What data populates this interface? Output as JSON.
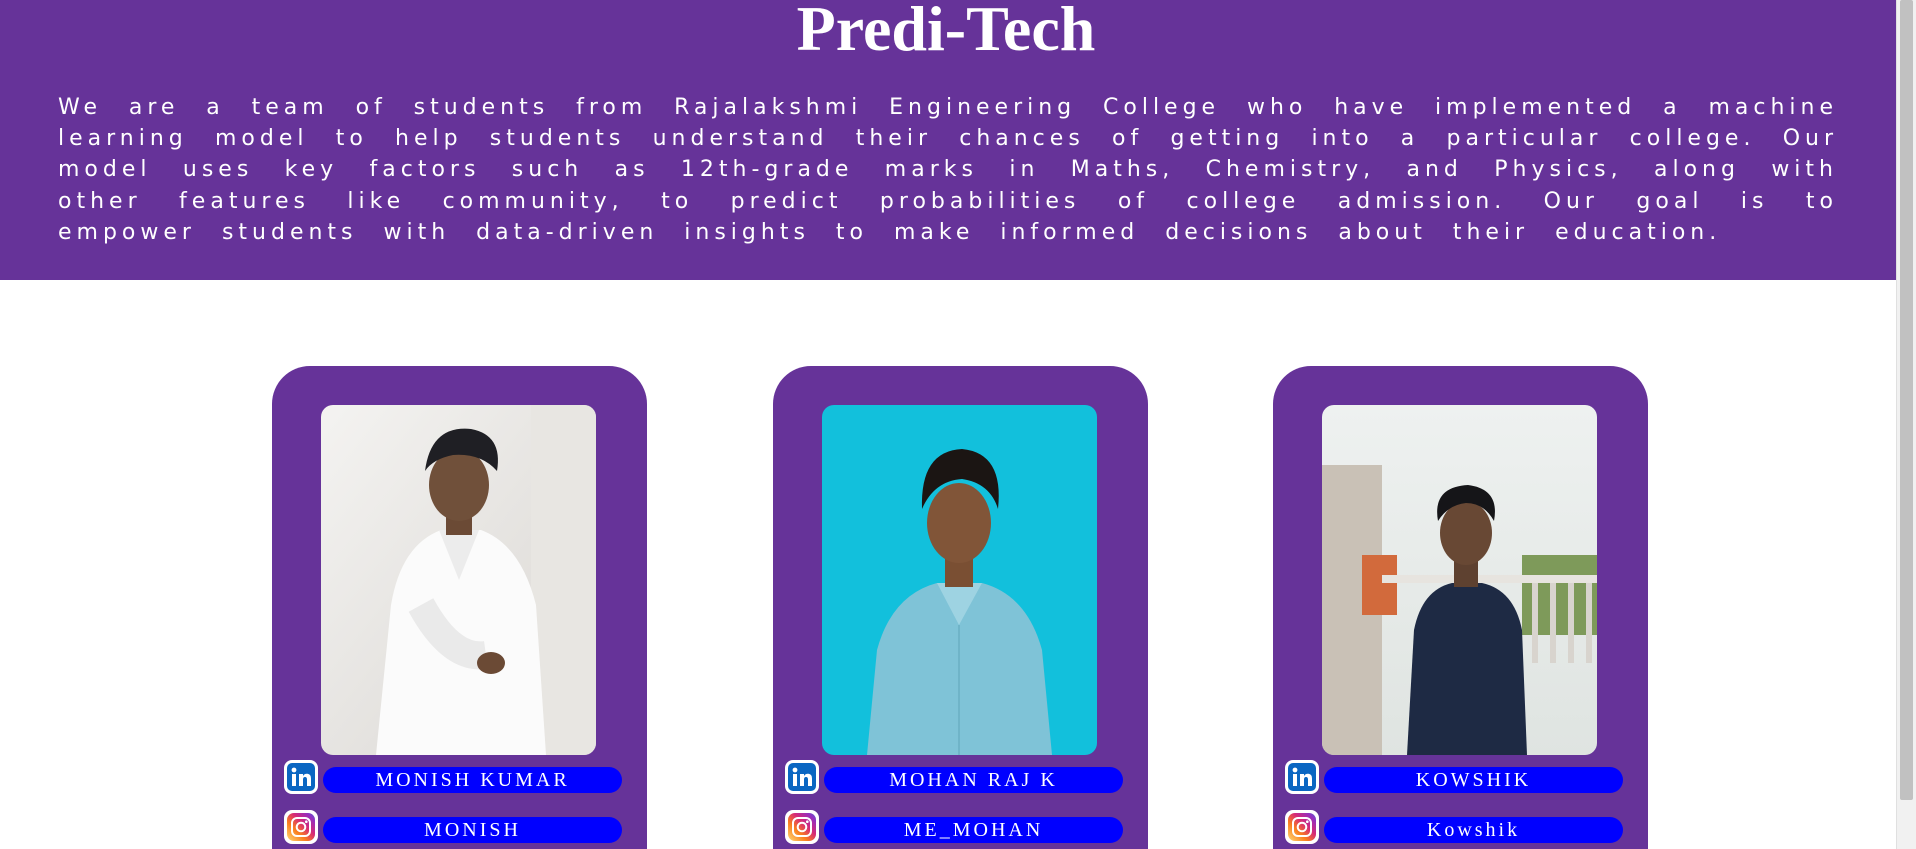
{
  "site": {
    "title": "Predi-Tech",
    "about": "We are a team of students from Rajalakshmi Engineering College who have implemented a machine learning model to help students understand their chances of getting into a particular college. Our model uses key factors such as 12th-grade marks in Maths, Chemistry, and Physics, along with other features like community, to predict probabilities of college admission. Our goal is to empower students with data-driven insights to make informed decisions about their education."
  },
  "colors": {
    "brand_purple": "#663399",
    "link_blue": "#0000ff",
    "text_white": "#ffffff",
    "linkedin_blue": "#0a66c2"
  },
  "team": [
    {
      "photo_alt": "photo of team member 1",
      "linkedin_icon": "linkedin-icon",
      "linkedin_label": "MONISH KUMAR",
      "instagram_icon": "instagram-icon",
      "instagram_label": "MONISH"
    },
    {
      "photo_alt": "photo of team member 2",
      "linkedin_icon": "linkedin-icon",
      "linkedin_label": "MOHAN RAJ K",
      "instagram_icon": "instagram-icon",
      "instagram_label": "ME_MOHAN"
    },
    {
      "photo_alt": "photo of team member 3",
      "linkedin_icon": "linkedin-icon",
      "linkedin_label": "KOWSHIK",
      "instagram_icon": "instagram-icon",
      "instagram_label": "Kowshik"
    }
  ]
}
